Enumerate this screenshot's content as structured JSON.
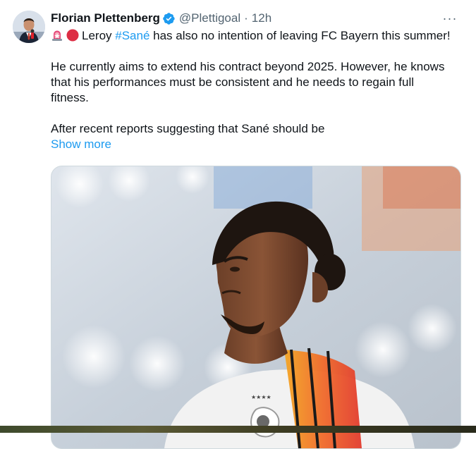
{
  "tweet": {
    "author": {
      "name": "Florian Plettenberg",
      "handle": "@Plettigoal",
      "verified": true
    },
    "separator": "·",
    "time": "12h",
    "more_label": "···",
    "text": {
      "line1_pre": "Leroy ",
      "hashtag": "#Sané",
      "line1_post": " has also no intention of leaving FC Bayern this summer!",
      "line2": "He currently aims to extend his contract beyond 2025. However, he knows",
      "line3": "that his performances must be consistent and he needs to regain full",
      "line4": "fitness.",
      "line5": "After recent reports suggesting that Sané should be"
    },
    "show_more": "Show more",
    "icons": {
      "leading": [
        "rotating-light-emoji",
        "red-circle-emoji"
      ],
      "verified": "verified-badge-icon",
      "more": "more-icon"
    },
    "colors": {
      "link": "#1d9bf0",
      "secondary_text": "#536471",
      "verified": "#1d9bf0"
    }
  }
}
